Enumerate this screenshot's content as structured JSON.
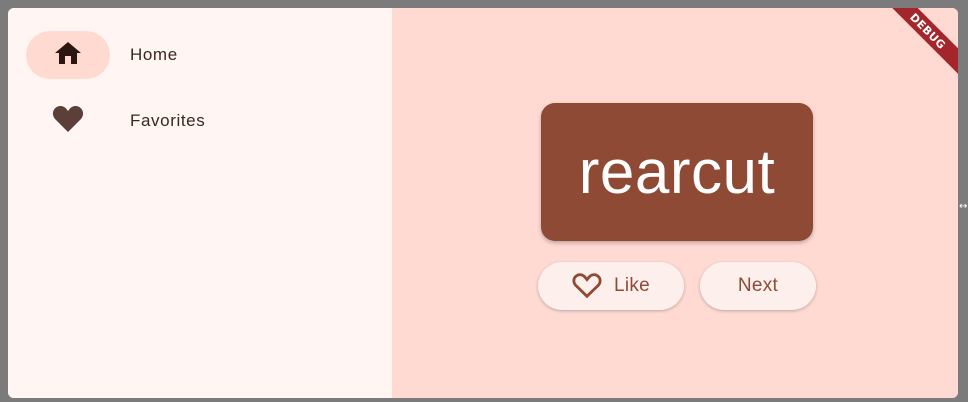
{
  "nav": {
    "items": [
      {
        "label": "Home",
        "icon": "home-icon",
        "selected": true
      },
      {
        "label": "Favorites",
        "icon": "heart-icon",
        "selected": false
      }
    ]
  },
  "main": {
    "word": "rearcut",
    "like_label": "Like",
    "next_label": "Next"
  },
  "banner": {
    "label": "DEBUG"
  },
  "colors": {
    "primary": "#8f4a36",
    "rail_bg": "#fff5f2",
    "content_bg": "#ffdad3",
    "indicator": "#ffdad1",
    "debug_banner": "#a3262a"
  }
}
